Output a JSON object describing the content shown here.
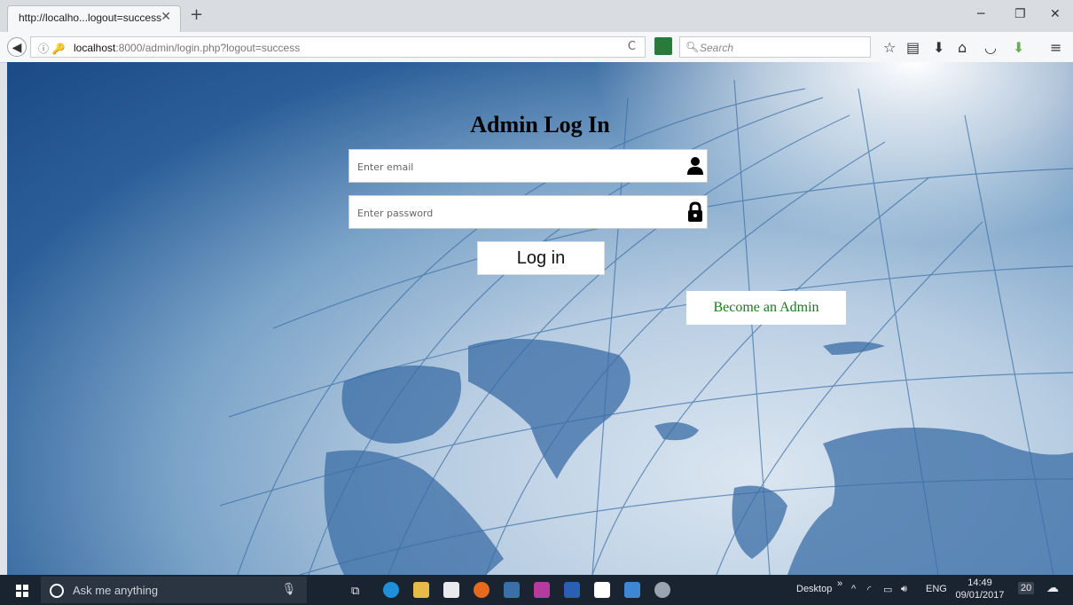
{
  "browser": {
    "tab_title": "http://localho...logout=success",
    "tab_close": "✕",
    "new_tab": "+",
    "url_host": "localhost",
    "url_rest": ":8000/admin/login.php?logout=success",
    "search_placeholder": "Search"
  },
  "page": {
    "title": "Admin Log In",
    "email_placeholder": "Enter email",
    "password_placeholder": "Enter password",
    "login_label": "Log in",
    "become_admin_label": "Become an Admin"
  },
  "taskbar": {
    "search_text": "Ask me anything",
    "desktop_label": "Desktop",
    "language": "ENG",
    "time": "14:49",
    "date": "09/01/2017",
    "notifications": "20"
  },
  "colors": {
    "become_admin_text": "#1a7a1a",
    "taskbar_bg": "#1a2330"
  }
}
